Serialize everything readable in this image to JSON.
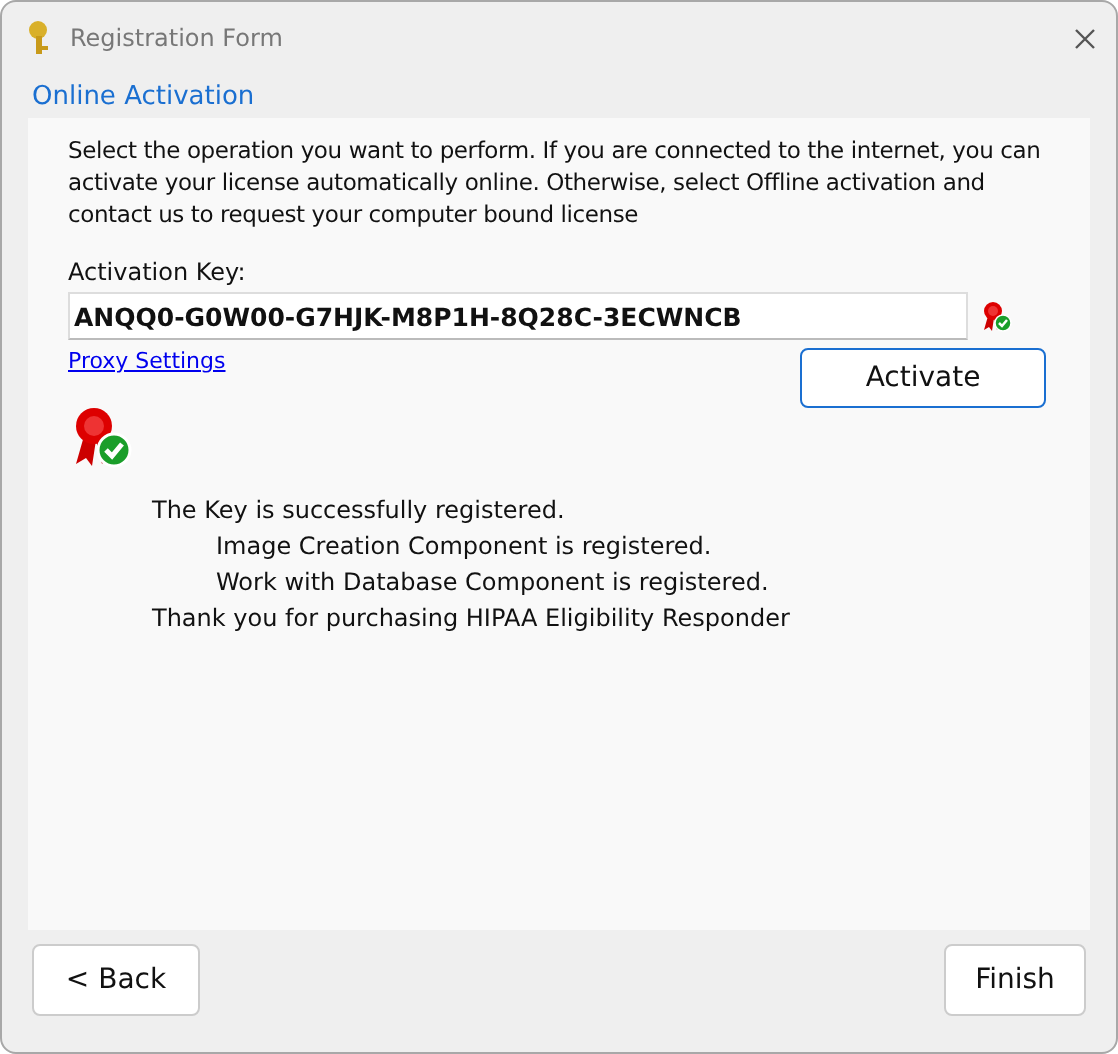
{
  "window": {
    "title": "Registration Form"
  },
  "section": {
    "title": "Online Activation"
  },
  "intro": "Select the operation you want to perform. If you are connected to the internet, you can activate your license automatically online. Otherwise, select Offline activation and contact us to request your computer bound license",
  "key_field": {
    "label": "Activation Key:",
    "value": "ANQQ0-G0W00-G7HJK-M8P1H-8Q28C-3ECWNCB"
  },
  "proxy_link": "Proxy Settings",
  "activate_button": "Activate",
  "messages": [
    {
      "text": "The Key is successfully registered.",
      "children": [
        {
          "text": "Image Creation Component is registered."
        },
        {
          "text": "Work with Database Component is registered."
        }
      ]
    },
    {
      "text": "Thank you for purchasing HIPAA Eligibility Responder"
    }
  ],
  "buttons": {
    "back": "< Back",
    "finish": "Finish"
  }
}
